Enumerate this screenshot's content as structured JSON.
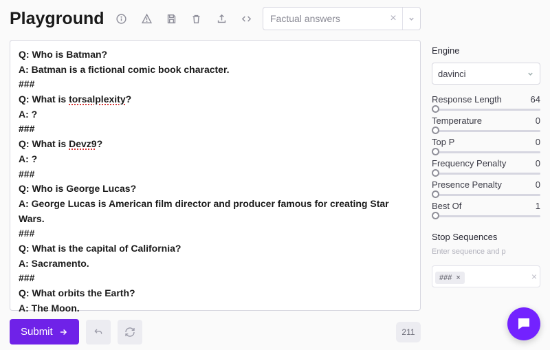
{
  "header": {
    "title": "Playground",
    "preset": "Factual answers"
  },
  "editor": {
    "lines": [
      {
        "t": "Q: Who is Batman?"
      },
      {
        "t": "A: Batman is a fictional comic book character."
      },
      {
        "t": "###"
      },
      {
        "t": "Q: What is ",
        "sq": "torsalplexity",
        "after": "?"
      },
      {
        "t": "A: ?"
      },
      {
        "t": "###"
      },
      {
        "t": "Q: What is ",
        "sq": "Devz9",
        "after": "?"
      },
      {
        "t": "A: ?"
      },
      {
        "t": "###"
      },
      {
        "t": "Q: Who is George Lucas?"
      },
      {
        "t": "A: George Lucas is American film director and producer famous for creating Star Wars."
      },
      {
        "t": "###"
      },
      {
        "t": "Q: What is the capital of California?"
      },
      {
        "t": "A: Sacramento."
      },
      {
        "t": "###"
      },
      {
        "t": "Q: What orbits the Earth?"
      },
      {
        "t": "A: The Moon."
      }
    ]
  },
  "footer": {
    "submit": "Submit",
    "counter": "211"
  },
  "sidebar": {
    "engine_label": "Engine",
    "engine_value": "davinci",
    "params": [
      {
        "label": "Response Length",
        "value": "64"
      },
      {
        "label": "Temperature",
        "value": "0"
      },
      {
        "label": "Top P",
        "value": "0"
      },
      {
        "label": "Frequency Penalty",
        "value": "0"
      },
      {
        "label": "Presence Penalty",
        "value": "0"
      },
      {
        "label": "Best Of",
        "value": "1"
      }
    ],
    "stop_label": "Stop Sequences",
    "stop_hint": "Enter sequence and p",
    "stop_tag": "###"
  }
}
